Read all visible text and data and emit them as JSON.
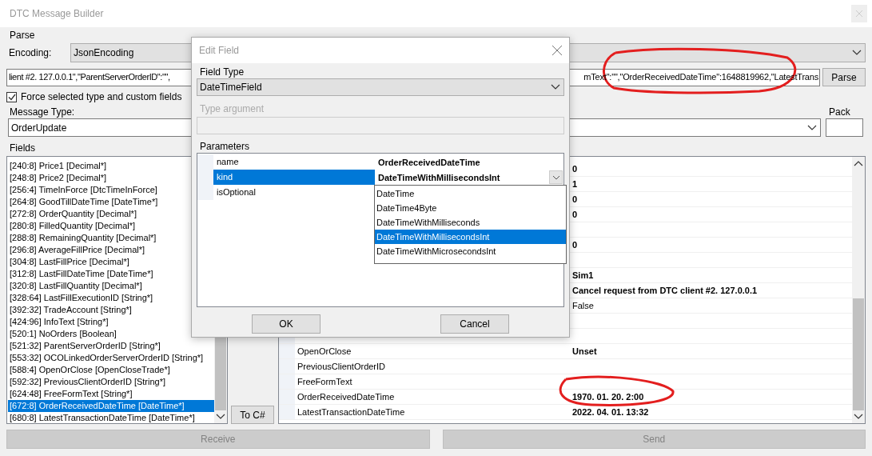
{
  "window": {
    "title": "DTC Message Builder"
  },
  "parse": {
    "group_label": "Parse",
    "encoding_label": "Encoding:",
    "encoding": "JsonEncoding",
    "input_text_left": "lient #2. 127.0.0.1\",\"ParentServerOrderID\":\"\",",
    "input_text_right": "mText\":\"\",\"OrderReceivedDateTime\":1648819962,\"LatestTrans",
    "parse_button": "Parse"
  },
  "force_checkbox": {
    "label": "Force selected type and custom fields",
    "checked": true
  },
  "message_type": {
    "group_label": "Message Type:",
    "value": "OrderUpdate"
  },
  "pack": {
    "group_label": "Pack"
  },
  "fields": {
    "group_label": "Fields",
    "items": [
      {
        "label": "[240:8] Price1 [Decimal*]",
        "selected": false
      },
      {
        "label": "[248:8] Price2 [Decimal*]",
        "selected": false
      },
      {
        "label": "[256:4] TimeInForce [DtcTimeInForce]",
        "selected": false
      },
      {
        "label": "[264:8] GoodTillDateTime [DateTime*]",
        "selected": false
      },
      {
        "label": "[272:8] OrderQuantity [Decimal*]",
        "selected": false
      },
      {
        "label": "[280:8] FilledQuantity [Decimal*]",
        "selected": false
      },
      {
        "label": "[288:8] RemainingQuantity [Decimal*]",
        "selected": false
      },
      {
        "label": "[296:8] AverageFillPrice [Decimal*]",
        "selected": false
      },
      {
        "label": "[304:8] LastFillPrice [Decimal*]",
        "selected": false
      },
      {
        "label": "[312:8] LastFillDateTime [DateTime*]",
        "selected": false
      },
      {
        "label": "[320:8] LastFillQuantity [Decimal*]",
        "selected": false
      },
      {
        "label": "[328:64] LastFillExecutionID [String*]",
        "selected": false
      },
      {
        "label": "[392:32] TradeAccount [String*]",
        "selected": false
      },
      {
        "label": "[424:96] InfoText [String*]",
        "selected": false
      },
      {
        "label": "[520:1] NoOrders [Boolean]",
        "selected": false
      },
      {
        "label": "[521:32] ParentServerOrderID [String*]",
        "selected": false
      },
      {
        "label": "[553:32] OCOLinkedOrderServerOrderID [String*]",
        "selected": false
      },
      {
        "label": "[588:4] OpenOrClose [OpenCloseTrade*]",
        "selected": false
      },
      {
        "label": "[592:32] PreviousClientOrderID [String*]",
        "selected": false
      },
      {
        "label": "[624:48] FreeFormText [String*]",
        "selected": false
      },
      {
        "label": "[672:8] OrderReceivedDateTime [DateTime*]",
        "selected": true
      },
      {
        "label": "[680:8] LatestTransactionDateTime [DateTime*]",
        "selected": false
      }
    ],
    "to_csharp_button": "To C#"
  },
  "properties": [
    {
      "kind": "value",
      "value": "0",
      "modified": true
    },
    {
      "kind": "value",
      "value": "1",
      "modified": true
    },
    {
      "kind": "value",
      "value": "0",
      "modified": true
    },
    {
      "kind": "value",
      "value": "0",
      "modified": true
    },
    {
      "kind": "empty"
    },
    {
      "kind": "value",
      "value": "0",
      "modified": true
    },
    {
      "kind": "empty"
    },
    {
      "kind": "value",
      "value": "Sim1",
      "modified": true
    },
    {
      "kind": "value",
      "value": "Cancel request from DTC client #2. 127.0.0.1",
      "modified": true
    },
    {
      "kind": "value",
      "value": "False",
      "modified": false
    },
    {
      "kind": "empty"
    },
    {
      "kind": "empty"
    },
    {
      "kind": "value",
      "name": "OpenOrClose",
      "value": "Unset",
      "modified": true
    },
    {
      "kind": "value",
      "name": "PreviousClientOrderID"
    },
    {
      "kind": "value",
      "name": "FreeFormText"
    },
    {
      "kind": "value",
      "name": "OrderReceivedDateTime",
      "value": "1970. 01. 20. 2:00",
      "modified": true
    },
    {
      "kind": "value",
      "name": "LatestTransactionDateTime",
      "value": "2022. 04. 01. 13:32",
      "modified": true
    }
  ],
  "bottom_buttons": [
    {
      "label": "Receive",
      "disabled": true
    },
    {
      "label": "Send",
      "disabled": true
    }
  ],
  "dialog": {
    "title": "Edit Field",
    "field_type_label": "Field Type",
    "field_type": "DateTimeField",
    "type_argument_label": "Type argument",
    "type_argument_disabled": true,
    "parameters_label": "Parameters",
    "parameters": [
      {
        "name": "name",
        "value": "OrderReceivedDateTime",
        "selected": false,
        "kind": "text"
      },
      {
        "name": "kind",
        "value": "DateTimeWithMillisecondsInt",
        "selected": true,
        "kind": "dropdown"
      },
      {
        "name": "isOptional",
        "selected": false,
        "kind": "text"
      }
    ],
    "dropdown_options": [
      {
        "label": "DateTime",
        "selected": false
      },
      {
        "label": "DateTime4Byte",
        "selected": false
      },
      {
        "label": "DateTimeWithMilliseconds",
        "selected": false
      },
      {
        "label": "DateTimeWithMillisecondsInt",
        "selected": true
      },
      {
        "label": "DateTimeWithMicrosecondsInt",
        "selected": false
      }
    ],
    "buttons": [
      "OK",
      "Cancel"
    ]
  }
}
